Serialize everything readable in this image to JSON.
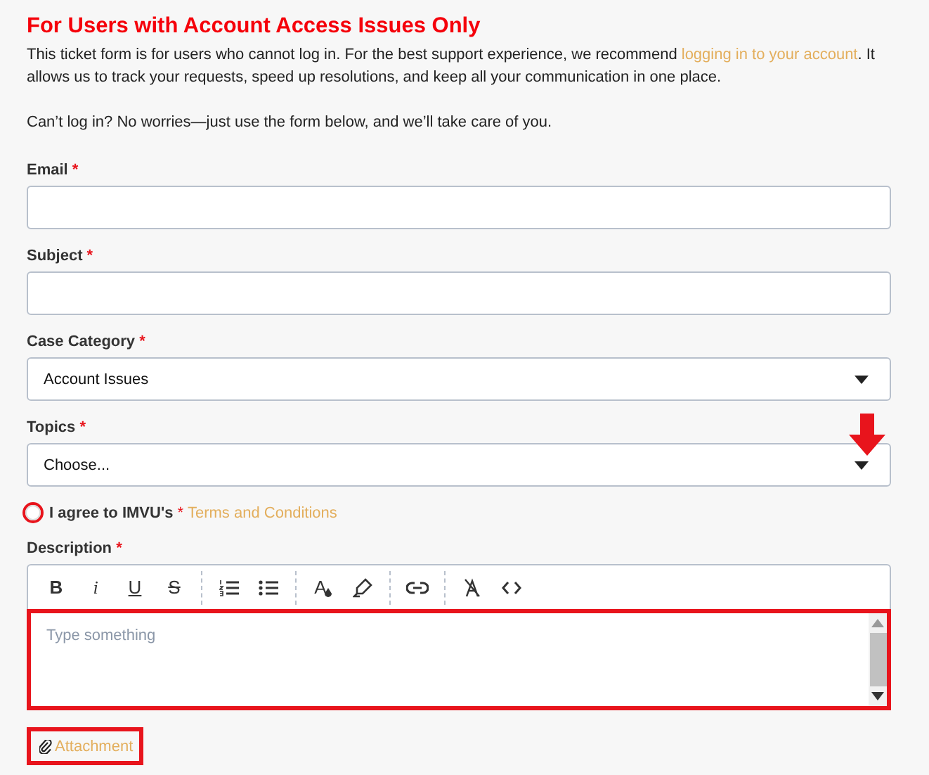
{
  "heading": "For Users with Account Access Issues Only",
  "intro": {
    "before": "This ticket form is for users who cannot log in. For the best support experience, we recommend ",
    "link": "logging in to your account",
    "after": ". It allows us to track your requests, speed up resolutions, and keep all your communication in one place."
  },
  "note": "Can’t log in? No worries—just use the form below, and we’ll take care of you.",
  "fields": [
    {
      "kind": "text",
      "label": "Email",
      "required": "*",
      "marked": false
    },
    {
      "kind": "text",
      "label": "Subject",
      "required": "*",
      "marked": false
    },
    {
      "kind": "select",
      "label": "Case Category",
      "required": "*",
      "value": "Account Issues",
      "marked": false
    },
    {
      "kind": "select",
      "label": "Topics",
      "required": "*",
      "value": "Choose...",
      "marked": true
    }
  ],
  "agreement": {
    "checked": false,
    "marked": true,
    "label": "I agree to IMVU's",
    "required": "*",
    "link": "Terms and Conditions"
  },
  "description": {
    "label": "Description",
    "required": "*",
    "toolbar": [
      [
        {
          "kind": "bold",
          "label": "B"
        },
        {
          "kind": "italic",
          "label": "i"
        },
        {
          "kind": "underline",
          "label": "U"
        },
        {
          "kind": "strike",
          "label": "S"
        }
      ],
      [
        {
          "kind": "ordered-list"
        },
        {
          "kind": "bullet-list"
        }
      ],
      [
        {
          "kind": "text-color",
          "label": "A"
        },
        {
          "kind": "highlighter"
        }
      ],
      [
        {
          "kind": "link"
        }
      ],
      [
        {
          "kind": "clear-format"
        },
        {
          "kind": "code"
        }
      ]
    ],
    "placeholder": "Type something",
    "marked": true
  },
  "attachment": {
    "label": "Attachment",
    "marked": true
  }
}
